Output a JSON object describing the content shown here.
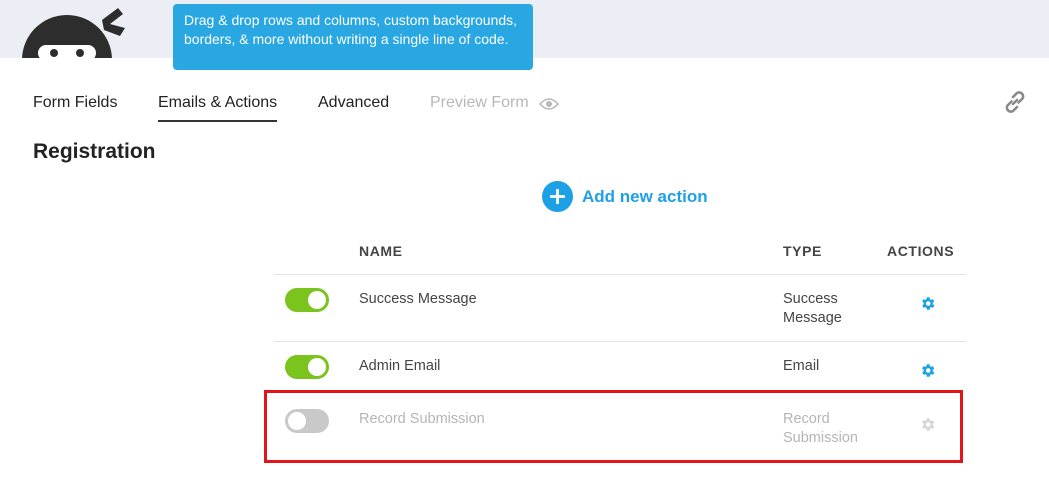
{
  "tooltip": {
    "text": "Drag & drop rows and columns, custom backgrounds, borders, & more without writing a single line of code."
  },
  "tabs": [
    {
      "label": "Form Fields",
      "state": "normal"
    },
    {
      "label": "Emails & Actions",
      "state": "active"
    },
    {
      "label": "Advanced",
      "state": "normal"
    },
    {
      "label": "Preview Form",
      "state": "disabled",
      "icon": "eye-icon"
    }
  ],
  "toolbar": {
    "link_icon": "link-icon"
  },
  "page": {
    "title": "Registration"
  },
  "add_action": {
    "label": "Add new action",
    "icon": "plus-icon"
  },
  "table": {
    "columns": {
      "name": "NAME",
      "type": "TYPE",
      "actions": "ACTIONS"
    },
    "rows": [
      {
        "enabled": true,
        "name": "Success Message",
        "type_line1": "Success",
        "type_line2": "Message",
        "action_icon": "gear-icon"
      },
      {
        "enabled": true,
        "name": "Admin Email",
        "type_line1": "Email",
        "type_line2": "",
        "action_icon": "gear-icon"
      },
      {
        "enabled": false,
        "name": "Record Submission",
        "type_line1": "Record",
        "type_line2": "Submission",
        "action_icon": "gear-icon"
      }
    ]
  },
  "colors": {
    "accent_blue": "#1ea0e6",
    "tooltip_blue": "#28a7e3",
    "toggle_on": "#7bc41d",
    "toggle_off": "#c9c9c9",
    "highlight_red": "#e4141b"
  }
}
